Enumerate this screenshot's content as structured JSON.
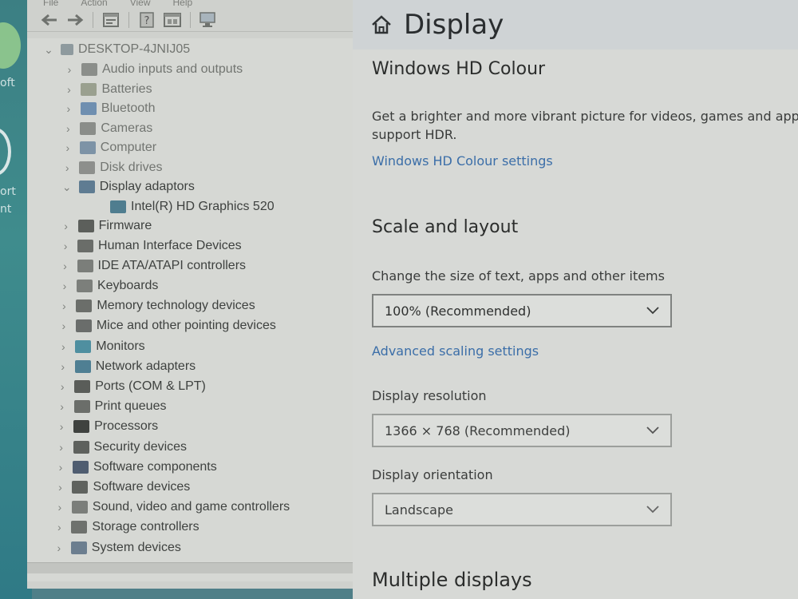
{
  "desktop": {
    "labels": [
      "oft",
      "ort",
      "nt"
    ]
  },
  "device_manager": {
    "menu": [
      "File",
      "Action",
      "View",
      "Help"
    ],
    "toolbar_icons": [
      "back-arrow-icon",
      "forward-arrow-icon",
      "properties-icon",
      "help-icon",
      "update-driver-icon",
      "monitor-scan-icon"
    ],
    "root": "DESKTOP-4JNIJ05",
    "items": [
      {
        "label": "Audio inputs and outputs",
        "expanded": false,
        "icon_color": "#8b8e8a"
      },
      {
        "label": "Batteries",
        "expanded": false,
        "icon_color": "#9aa08f"
      },
      {
        "label": "Bluetooth",
        "expanded": false,
        "icon_color": "#6f8fb0"
      },
      {
        "label": "Cameras",
        "expanded": false,
        "icon_color": "#8a8d89"
      },
      {
        "label": "Computer",
        "expanded": false,
        "icon_color": "#7d93a6"
      },
      {
        "label": "Disk drives",
        "expanded": false,
        "icon_color": "#8d8f8c"
      },
      {
        "label": "Display adaptors",
        "expanded": true,
        "icon_color": "#5f7c92"
      },
      {
        "label": "Intel(R) HD Graphics 520",
        "expanded": null,
        "child": true,
        "icon_color": "#4f7d8f"
      },
      {
        "label": "Firmware",
        "expanded": false,
        "icon_color": "#5c5f5b"
      },
      {
        "label": "Human Interface Devices",
        "expanded": false,
        "icon_color": "#6a6d69"
      },
      {
        "label": "IDE ATA/ATAPI controllers",
        "expanded": false,
        "icon_color": "#7b7e7a"
      },
      {
        "label": "Keyboards",
        "expanded": false,
        "icon_color": "#7c7f7b"
      },
      {
        "label": "Memory technology devices",
        "expanded": false,
        "icon_color": "#6b6e6a"
      },
      {
        "label": "Mice and other pointing devices",
        "expanded": false,
        "icon_color": "#6a6d6b"
      },
      {
        "label": "Monitors",
        "expanded": false,
        "icon_color": "#4f8fa0"
      },
      {
        "label": "Network adapters",
        "expanded": false,
        "icon_color": "#4f7f93"
      },
      {
        "label": "Ports (COM & LPT)",
        "expanded": false,
        "icon_color": "#5a5d59"
      },
      {
        "label": "Print queues",
        "expanded": false,
        "icon_color": "#6b6e6a"
      },
      {
        "label": "Processors",
        "expanded": false,
        "icon_color": "#3f423f"
      },
      {
        "label": "Security devices",
        "expanded": false,
        "icon_color": "#5e615d"
      },
      {
        "label": "Software components",
        "expanded": false,
        "icon_color": "#4f5d70"
      },
      {
        "label": "Software devices",
        "expanded": false,
        "icon_color": "#5f625e"
      },
      {
        "label": "Sound, video and game controllers",
        "expanded": false,
        "icon_color": "#7b7e7a"
      },
      {
        "label": "Storage controllers",
        "expanded": false,
        "icon_color": "#6e716d"
      },
      {
        "label": "System devices",
        "expanded": false,
        "icon_color": "#6c7e8f"
      }
    ]
  },
  "settings": {
    "title": "Display",
    "hdr": {
      "heading": "Windows HD Colour",
      "description": "Get a brighter and more vibrant picture for videos, games and app support HDR.",
      "link": "Windows HD Colour settings"
    },
    "scale": {
      "heading": "Scale and layout",
      "size_label": "Change the size of text, apps and other items",
      "size_value": "100% (Recommended)",
      "advanced_link": "Advanced scaling settings",
      "resolution_label": "Display resolution",
      "resolution_value": "1366 × 768 (Recommended)",
      "orientation_label": "Display orientation",
      "orientation_value": "Landscape"
    },
    "multiple": {
      "heading": "Multiple displays"
    }
  },
  "colors": {
    "link": "#3b6ea8",
    "window_bg": "#d7d9d6",
    "tree_bg": "#d6d8d4"
  }
}
